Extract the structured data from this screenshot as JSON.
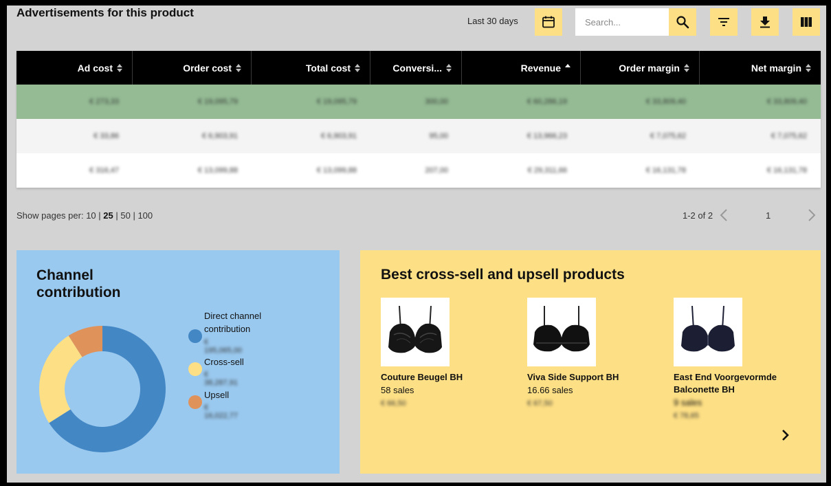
{
  "header": {
    "title": "Advertisements for this product",
    "date_range": "Last 30 days",
    "search_placeholder": "Search..."
  },
  "colors": {
    "accent": "#fddf85",
    "highlight_row": "#94bb94",
    "channel_card": "#9ac9ef",
    "direct": "#4487c5",
    "cross_sell": "#fddf85",
    "upsell": "#e0925b"
  },
  "table": {
    "columns": [
      {
        "label": "Ad cost",
        "sort": "both"
      },
      {
        "label": "Order cost",
        "sort": "both"
      },
      {
        "label": "Total cost",
        "sort": "both"
      },
      {
        "label": "Conversi...",
        "sort": "both"
      },
      {
        "label": "Revenue",
        "sort": "asc"
      },
      {
        "label": "Order margin",
        "sort": "both"
      },
      {
        "label": "Net margin",
        "sort": "both"
      }
    ],
    "rows": [
      [
        "€ 273,33",
        "€ 19,095,79",
        "€ 19,095,79",
        "300,00",
        "€ 60,286,19",
        "€ 33,809,40",
        "€ 33,809,40"
      ],
      [
        "€ 33,86",
        "€ 6,903,91",
        "€ 6,903,91",
        "95,00",
        "€ 13,966,23",
        "€ 7,075,62",
        "€ 7,075,62"
      ],
      [
        "€ 316,47",
        "€ 13,099,88",
        "€ 13,099,88",
        "207,00",
        "€ 29,311,66",
        "€ 16,131,78",
        "€ 16,131,78"
      ]
    ]
  },
  "pagination": {
    "label": "Show pages per:",
    "options": [
      "10",
      "25",
      "50",
      "100"
    ],
    "selected": "25",
    "range": "1-2 of 2",
    "current_page": "1"
  },
  "channel": {
    "title": "Channel contribution",
    "items": [
      {
        "label": "Direct channel contribution",
        "value": "€ 195,065,00",
        "share": 0.66
      },
      {
        "label": "Cross-sell",
        "value": "€ 38,287,91",
        "share": 0.25
      },
      {
        "label": "Upsell",
        "value": "€ 16,022,77",
        "share": 0.09
      }
    ]
  },
  "cross_sell": {
    "title": "Best cross-sell and upsell products",
    "products": [
      {
        "name": "Couture Beugel BH",
        "sales": "58 sales",
        "price": "€ 66,50"
      },
      {
        "name": "Viva Side Support BH",
        "sales": "16.66 sales",
        "price": "€ 67,50"
      },
      {
        "name": "East End Voorgevormde Balconette BH",
        "sales": "9 sales",
        "price": "€ 78,65"
      }
    ]
  },
  "icons": {
    "date": "calendar-icon",
    "search": "search-icon",
    "filter": "filter-icon",
    "download": "download-icon",
    "columns": "columns-icon",
    "pager_prev": "chevron-left-icon",
    "pager_next": "chevron-right-icon",
    "carousel_next": "chevron-right-icon"
  }
}
